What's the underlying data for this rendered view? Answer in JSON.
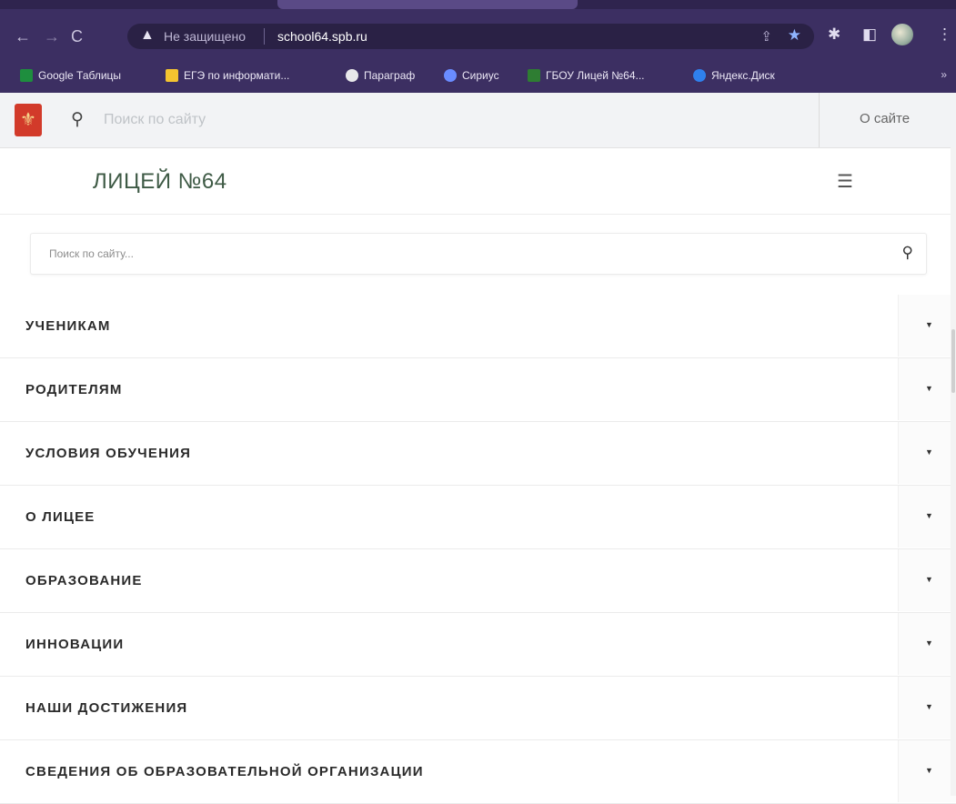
{
  "browser": {
    "not_secure": "Не защищено",
    "url": "school64.spb.ru",
    "nav": {
      "back": "←",
      "forward": "→",
      "reload": "C"
    },
    "bookmarks": [
      {
        "label": "Google Таблицы",
        "icon": "sheets-icon",
        "color": "#1e8e3e"
      },
      {
        "label": "ЕГЭ по информати...",
        "icon": "k-icon",
        "color": "#f4c430"
      },
      {
        "label": "Параграф",
        "icon": "paragraph-icon",
        "color": "#e8e8ea"
      },
      {
        "label": "Сириус",
        "icon": "sirius-icon",
        "color": "#6a8cff"
      },
      {
        "label": "ГБОУ Лицей №64...",
        "icon": "school-icon",
        "color": "#2e7d32"
      },
      {
        "label": "Яндекс.Диск",
        "icon": "disk-icon",
        "color": "#2f80ed"
      }
    ],
    "more": "»"
  },
  "site_header": {
    "search_placeholder": "Поиск по сайту",
    "about": "О сайте"
  },
  "brand": {
    "title": "ЛИЦЕЙ №64"
  },
  "search": {
    "placeholder": "Поиск по сайту..."
  },
  "menu": {
    "items": [
      {
        "label": "УЧЕНИКАМ"
      },
      {
        "label": "РОДИТЕЛЯМ"
      },
      {
        "label": "УСЛОВИЯ ОБУЧЕНИЯ"
      },
      {
        "label": "О ЛИЦЕЕ"
      },
      {
        "label": "ОБРАЗОВАНИЕ"
      },
      {
        "label": "ИННОВАЦИИ"
      },
      {
        "label": "НАШИ ДОСТИЖЕНИЯ"
      },
      {
        "label": "СВЕДЕНИЯ ОБ ОБРАЗОВАТЕЛЬНОЙ ОРГАНИЗАЦИИ"
      }
    ]
  }
}
